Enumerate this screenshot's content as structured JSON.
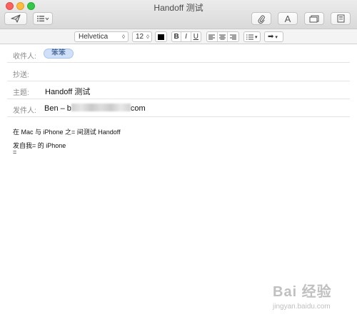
{
  "window": {
    "title": "Handoff 测试"
  },
  "toolbar": {
    "send_icon": "paper-plane-icon",
    "header_menu_icon": "list-icon",
    "attach_icon": "paperclip-icon",
    "fonts_label": "A",
    "photo_icon": "photo-browser-icon",
    "stationery_icon": "stationery-icon"
  },
  "format": {
    "font": "Helvetica",
    "size": "12",
    "bold": "B",
    "italic": "I",
    "underline": "U"
  },
  "fields": {
    "to_label": "收件人:",
    "to_chip": "笨笨",
    "cc_label": "抄送:",
    "subject_label": "主题:",
    "subject_value": "Handoff 测试",
    "from_label": "发件人:",
    "from_prefix": "Ben – b",
    "from_suffix": "com"
  },
  "body": {
    "line1": "在 Mac 与 iPhone 之= 间测试 Handoff",
    "line2": "发自我= 的 iPhone",
    "line3": "="
  },
  "watermark": {
    "logo": "Bai 经验",
    "url": "jingyan.baidu.com"
  }
}
